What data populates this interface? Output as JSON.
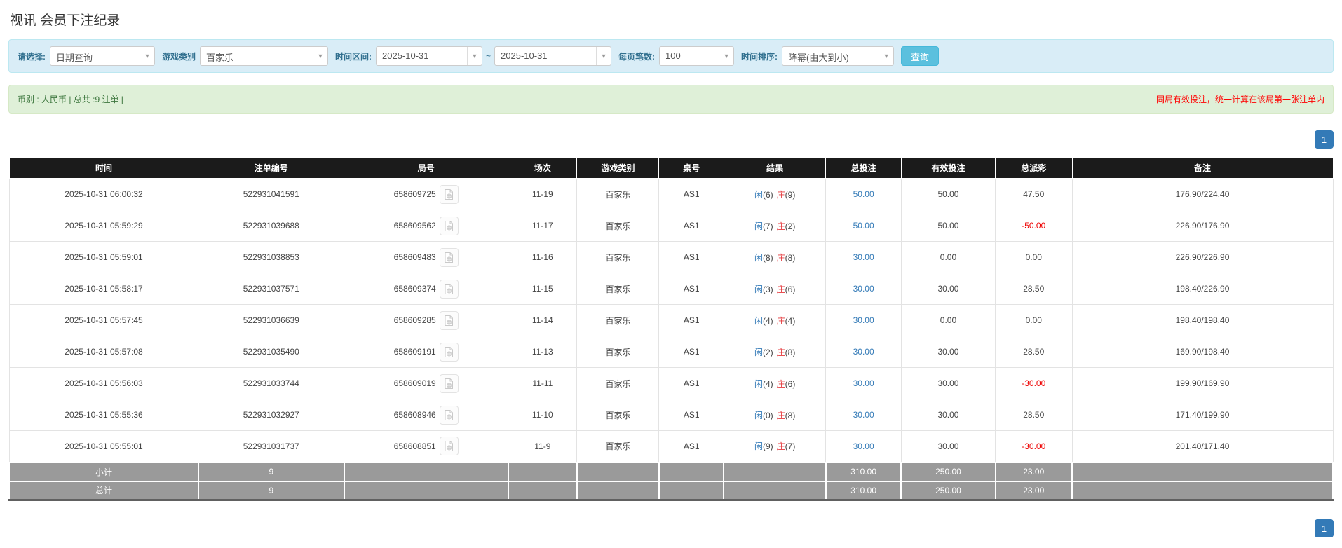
{
  "page": {
    "title": "视讯 会员下注纪录"
  },
  "filter": {
    "query_type": {
      "label": "请选择:",
      "value": "日期查询"
    },
    "game_type": {
      "label": "游戏类别",
      "value": "百家乐"
    },
    "date_range": {
      "label": "时间区间:",
      "from": "2025-10-31",
      "separator": "~",
      "to": "2025-10-31"
    },
    "page_size": {
      "label": "每页笔数:",
      "value": "100"
    },
    "sort": {
      "label": "时间排序:",
      "value": "降幂(由大到小)"
    },
    "search_button": "查询"
  },
  "summary_bar": {
    "currency_info": "币别 : 人民币 | 总共 :9 注单 |",
    "notice": "同局有效投注，统一计算在该局第一张注单内"
  },
  "pagination": {
    "current_page": "1"
  },
  "table": {
    "headers": [
      "时间",
      "注单编号",
      "局号",
      "场次",
      "游戏类别",
      "桌号",
      "结果",
      "总投注",
      "有效投注",
      "总派彩",
      "备注"
    ],
    "rows": [
      {
        "time": "2025-10-31 06:00:32",
        "bet_no": "522931041591",
        "round_no": "658609725",
        "session": "11-19",
        "game": "百家乐",
        "table_no": "AS1",
        "result": {
          "player": "闲",
          "player_score": "(6)",
          "banker": "庄",
          "banker_score": "(9)"
        },
        "total_bet": "50.00",
        "valid_bet": "50.00",
        "payout": "47.50",
        "remark": "176.90/224.40"
      },
      {
        "time": "2025-10-31 05:59:29",
        "bet_no": "522931039688",
        "round_no": "658609562",
        "session": "11-17",
        "game": "百家乐",
        "table_no": "AS1",
        "result": {
          "player": "闲",
          "player_score": "(7)",
          "banker": "庄",
          "banker_score": "(2)"
        },
        "total_bet": "50.00",
        "valid_bet": "50.00",
        "payout": "-50.00",
        "remark": "226.90/176.90"
      },
      {
        "time": "2025-10-31 05:59:01",
        "bet_no": "522931038853",
        "round_no": "658609483",
        "session": "11-16",
        "game": "百家乐",
        "table_no": "AS1",
        "result": {
          "player": "闲",
          "player_score": "(8)",
          "banker": "庄",
          "banker_score": "(8)"
        },
        "total_bet": "30.00",
        "valid_bet": "0.00",
        "payout": "0.00",
        "remark": "226.90/226.90"
      },
      {
        "time": "2025-10-31 05:58:17",
        "bet_no": "522931037571",
        "round_no": "658609374",
        "session": "11-15",
        "game": "百家乐",
        "table_no": "AS1",
        "result": {
          "player": "闲",
          "player_score": "(3)",
          "banker": "庄",
          "banker_score": "(6)"
        },
        "total_bet": "30.00",
        "valid_bet": "30.00",
        "payout": "28.50",
        "remark": "198.40/226.90"
      },
      {
        "time": "2025-10-31 05:57:45",
        "bet_no": "522931036639",
        "round_no": "658609285",
        "session": "11-14",
        "game": "百家乐",
        "table_no": "AS1",
        "result": {
          "player": "闲",
          "player_score": "(4)",
          "banker": "庄",
          "banker_score": "(4)"
        },
        "total_bet": "30.00",
        "valid_bet": "0.00",
        "payout": "0.00",
        "remark": "198.40/198.40"
      },
      {
        "time": "2025-10-31 05:57:08",
        "bet_no": "522931035490",
        "round_no": "658609191",
        "session": "11-13",
        "game": "百家乐",
        "table_no": "AS1",
        "result": {
          "player": "闲",
          "player_score": "(2)",
          "banker": "庄",
          "banker_score": "(8)"
        },
        "total_bet": "30.00",
        "valid_bet": "30.00",
        "payout": "28.50",
        "remark": "169.90/198.40"
      },
      {
        "time": "2025-10-31 05:56:03",
        "bet_no": "522931033744",
        "round_no": "658609019",
        "session": "11-11",
        "game": "百家乐",
        "table_no": "AS1",
        "result": {
          "player": "闲",
          "player_score": "(4)",
          "banker": "庄",
          "banker_score": "(6)"
        },
        "total_bet": "30.00",
        "valid_bet": "30.00",
        "payout": "-30.00",
        "remark": "199.90/169.90"
      },
      {
        "time": "2025-10-31 05:55:36",
        "bet_no": "522931032927",
        "round_no": "658608946",
        "session": "11-10",
        "game": "百家乐",
        "table_no": "AS1",
        "result": {
          "player": "闲",
          "player_score": "(0)",
          "banker": "庄",
          "banker_score": "(8)"
        },
        "total_bet": "30.00",
        "valid_bet": "30.00",
        "payout": "28.50",
        "remark": "171.40/199.90"
      },
      {
        "time": "2025-10-31 05:55:01",
        "bet_no": "522931031737",
        "round_no": "658608851",
        "session": "11-9",
        "game": "百家乐",
        "table_no": "AS1",
        "result": {
          "player": "闲",
          "player_score": "(9)",
          "banker": "庄",
          "banker_score": "(7)"
        },
        "total_bet": "30.00",
        "valid_bet": "30.00",
        "payout": "-30.00",
        "remark": "201.40/171.40"
      }
    ],
    "subtotal_row": {
      "label": "小计",
      "count": "9",
      "total_bet": "310.00",
      "valid_bet": "250.00",
      "payout": "23.00"
    },
    "total_row": {
      "label": "总计",
      "count": "9",
      "total_bet": "310.00",
      "valid_bet": "250.00",
      "payout": "23.00"
    }
  },
  "colors": {
    "accent_blue": "#337ab7",
    "filter_bg": "#d9edf7",
    "summary_bg": "#dff0d8",
    "header_bg": "#1b1b1b",
    "player_blue": "#337ab7",
    "banker_red": "#e4393c",
    "negative_red": "#ee0000",
    "totals_grey": "#9a9a9a",
    "search_btn_bg": "#5bc0de"
  }
}
